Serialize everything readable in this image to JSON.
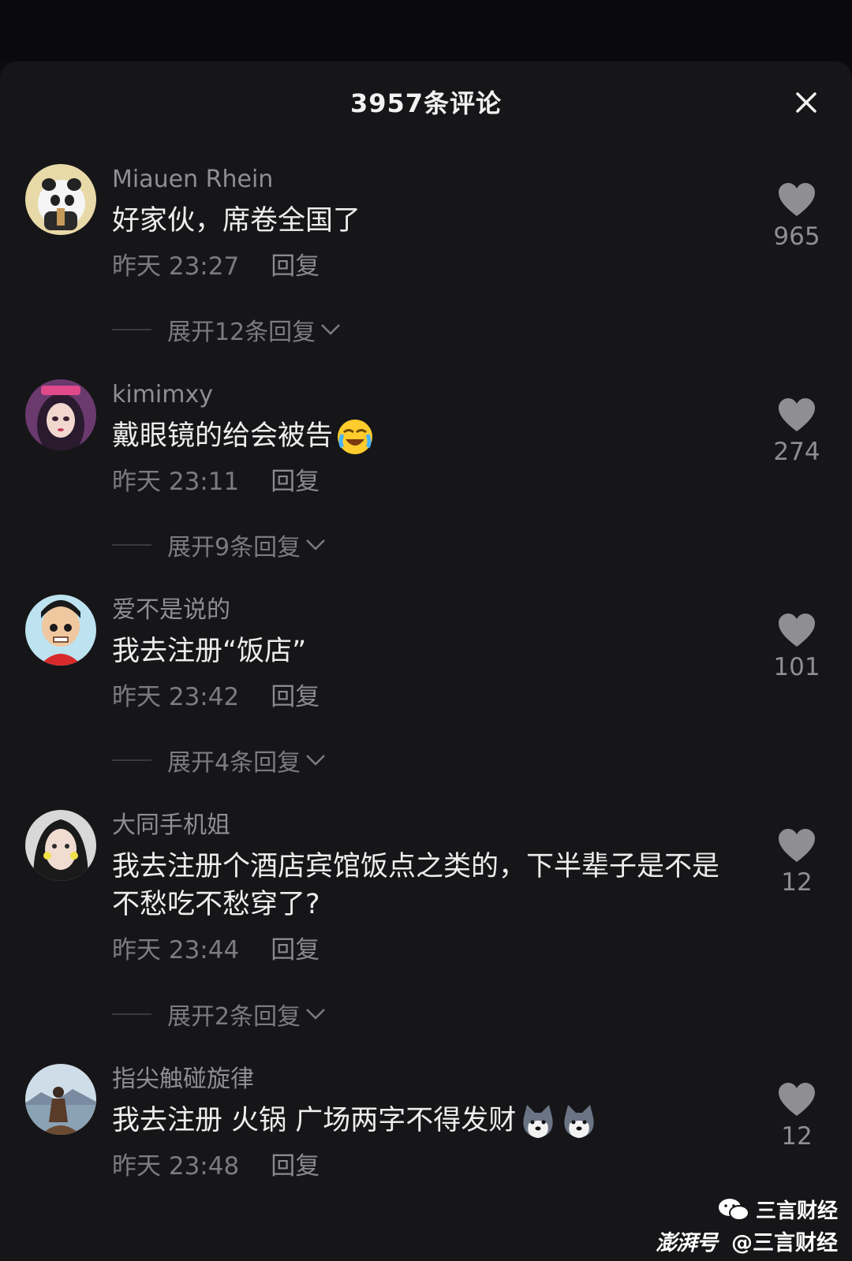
{
  "header": {
    "title": "3957条评论"
  },
  "comments": [
    {
      "username": "Miauen Rhein",
      "text": "好家伙，席卷全国了",
      "time": "昨天 23:27",
      "reply": "回复",
      "expand": "展开12条回复",
      "likes": "965"
    },
    {
      "username": "kimimxy",
      "text": "戴眼镜的给会被告",
      "time": "昨天 23:11",
      "reply": "回复",
      "expand": "展开9条回复",
      "likes": "274"
    },
    {
      "username": "爱不是说的",
      "text": "我去注册“饭店”",
      "time": "昨天 23:42",
      "reply": "回复",
      "expand": "展开4条回复",
      "likes": "101"
    },
    {
      "username": "大同手机姐",
      "text": "我去注册个酒店宾馆饭点之类的，下半辈子是不是不愁吃不愁穿了?",
      "time": "昨天 23:44",
      "reply": "回复",
      "expand": "展开2条回复",
      "likes": "12"
    },
    {
      "username": "指尖触碰旋律",
      "text": "我去注册 火锅 广场两字不得发财",
      "time": "昨天 23:48",
      "reply": "回复",
      "likes": "12"
    }
  ],
  "watermark": {
    "line1": "三言财经",
    "logo": "澎湃号",
    "line2": "@三言财经"
  },
  "colors": {
    "background": "#161618",
    "text": "#ededed",
    "muted": "#8e8e93"
  }
}
